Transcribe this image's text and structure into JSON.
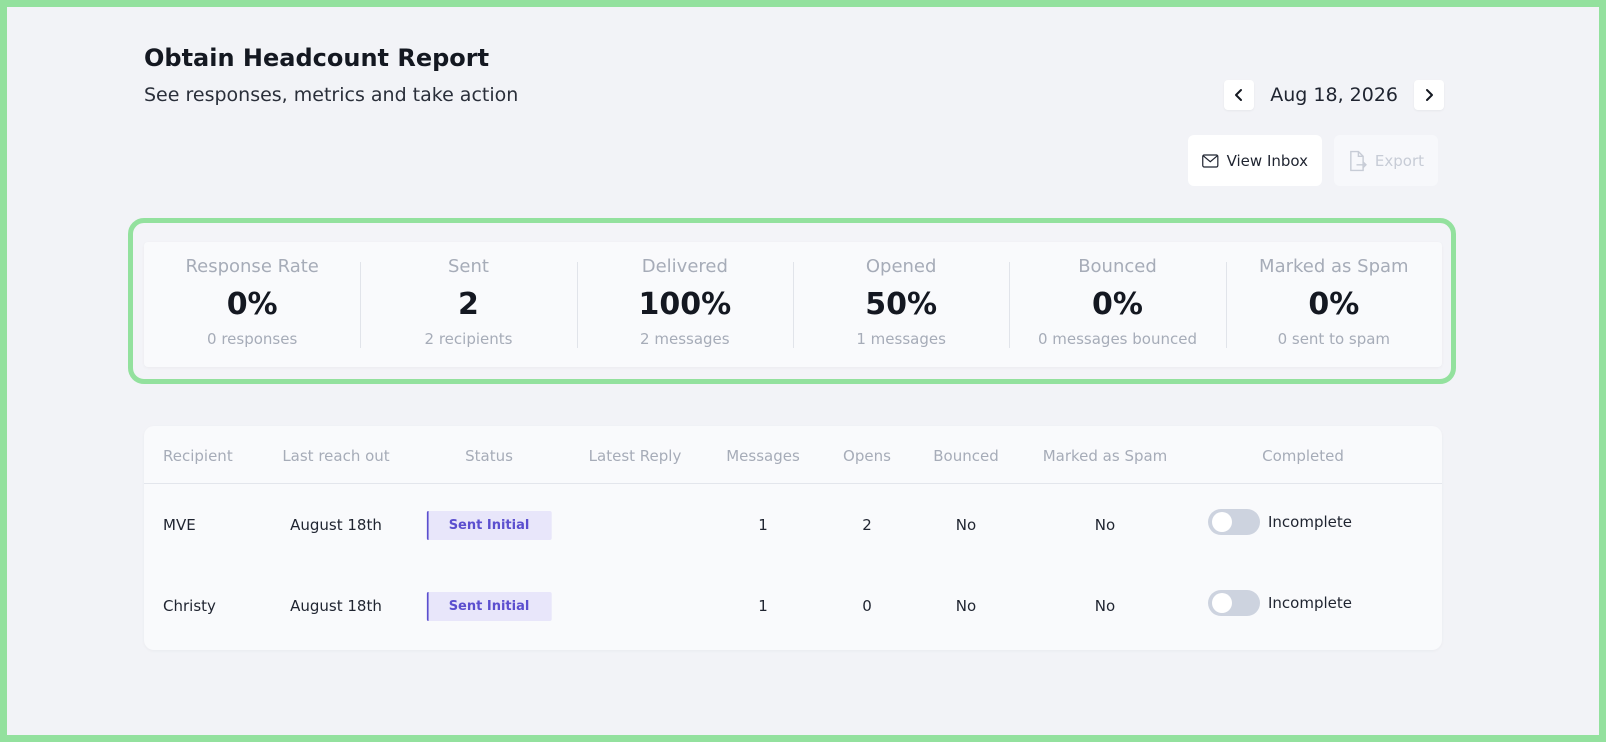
{
  "header": {
    "title": "Obtain Headcount Report",
    "subtitle": "See responses, metrics and take action",
    "date": "Aug 18, 2026"
  },
  "actions": {
    "view_inbox": "View Inbox",
    "export": "Export"
  },
  "metrics": [
    {
      "label": "Response Rate",
      "value": "0%",
      "sub": "0 responses"
    },
    {
      "label": "Sent",
      "value": "2",
      "sub": "2 recipients"
    },
    {
      "label": "Delivered",
      "value": "100%",
      "sub": "2 messages"
    },
    {
      "label": "Opened",
      "value": "50%",
      "sub": "1 messages"
    },
    {
      "label": "Bounced",
      "value": "0%",
      "sub": "0 messages bounced"
    },
    {
      "label": "Marked as Spam",
      "value": "0%",
      "sub": "0 sent to spam"
    }
  ],
  "table": {
    "headers": {
      "recipient": "Recipient",
      "last_reach_out": "Last reach out",
      "status": "Status",
      "latest_reply": "Latest Reply",
      "messages": "Messages",
      "opens": "Opens",
      "bounced": "Bounced",
      "spam": "Marked as Spam",
      "completed": "Completed"
    },
    "rows": [
      {
        "recipient": "MVE",
        "last_reach_out": "August 18th",
        "status": "Sent Initial",
        "latest_reply": "",
        "messages": "1",
        "opens": "2",
        "bounced": "No",
        "spam": "No",
        "completed": "Incomplete"
      },
      {
        "recipient": "Christy",
        "last_reach_out": "August 18th",
        "status": "Sent Initial",
        "latest_reply": "",
        "messages": "1",
        "opens": "0",
        "bounced": "No",
        "spam": "No",
        "completed": "Incomplete"
      }
    ]
  },
  "colors": {
    "highlight": "#93e19e",
    "badge_bg": "#e8e6fa",
    "badge_text": "#5b4fcf",
    "toggle_off": "#cdd3df"
  }
}
